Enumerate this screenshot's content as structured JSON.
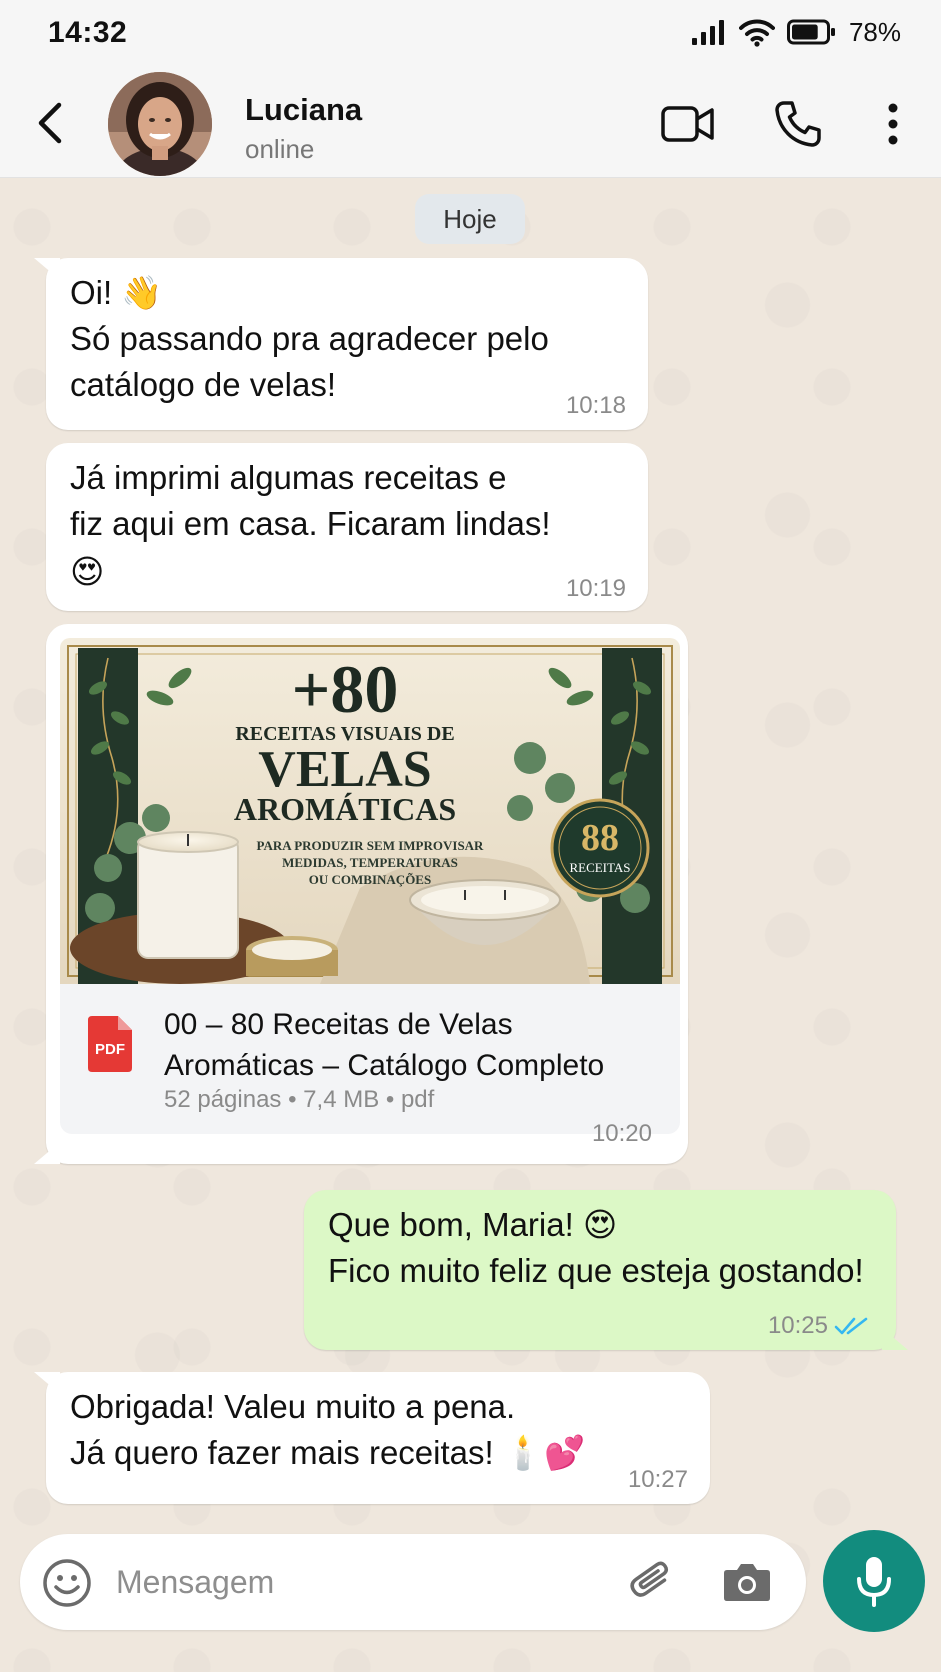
{
  "status_bar": {
    "time": "14:32",
    "battery_percent": "78%",
    "battery_level": 0.78,
    "icons": [
      "signal-icon",
      "wifi-icon",
      "battery-icon"
    ]
  },
  "header": {
    "contact_name": "Luciana",
    "contact_status": "online",
    "icons": [
      "back-arrow-icon",
      "video-call-icon",
      "phone-icon",
      "more-vert-icon"
    ]
  },
  "chat": {
    "date_label": "Hoje",
    "messages": [
      {
        "direction": "in",
        "lines": [
          "Oi! 👋",
          "Só passando pra agradecer pelo",
          "catálogo de velas!"
        ],
        "time": "10:18"
      },
      {
        "direction": "in",
        "lines": [
          "Já imprimi algumas receitas e",
          "fiz aqui em casa. Ficaram lindas!",
          "😍"
        ],
        "time": "10:19"
      },
      {
        "direction": "in",
        "type": "document",
        "preview": {
          "plus_number": "+80",
          "line1": "RECEITAS VISUAIS DE",
          "line2": "VELAS",
          "line3": "AROMÁTICAS",
          "sub1": "PARA PRODUZIR SEM IMPROVISAR",
          "sub2": "MEDIDAS, TEMPERATURAS",
          "sub3": "OU COMBINAÇÕES",
          "seal_number": "88",
          "seal_label": "RECEITAS"
        },
        "pdf_label": "PDF",
        "file_name_line1": "00 – 80 Receitas de Velas",
        "file_name_line2": "Aromáticas – Catálogo Completo",
        "file_meta": "52 páginas • 7,4 MB • pdf",
        "time": "10:20"
      },
      {
        "direction": "out",
        "lines": [
          "Que bom, Maria! 😍",
          "Fico muito feliz que esteja gostando!"
        ],
        "time": "10:25",
        "read": true
      },
      {
        "direction": "in",
        "lines": [
          "Obrigada! Valeu muito a pena.",
          "Já quero fazer mais receitas! 🕯️💕"
        ],
        "time": "10:27"
      }
    ]
  },
  "composer": {
    "placeholder": "Mensagem",
    "value": "",
    "icons": [
      "emoji-icon",
      "attach-icon",
      "camera-icon",
      "mic-icon"
    ]
  },
  "colors": {
    "chat_background": "#efe7dd",
    "incoming_bubble": "#ffffff",
    "outgoing_bubble": "#dcf8c6",
    "accent": "#128c7e",
    "read_ticks": "#34b7f1"
  }
}
